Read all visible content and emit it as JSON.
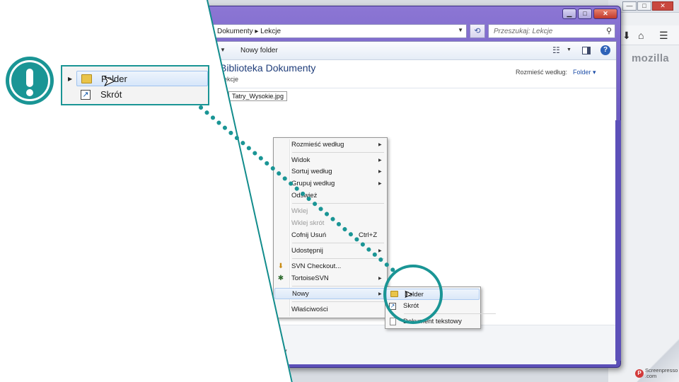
{
  "callout": {
    "zoom_items": [
      {
        "label": "Folder",
        "icon": "folder-icon",
        "highlighted": true
      },
      {
        "label": "Skrót",
        "icon": "shortcut-icon",
        "highlighted": false
      }
    ]
  },
  "background_app": {
    "brand_text": "mozilla"
  },
  "explorer": {
    "breadcrumb": "Dokumenty ▸ Lekcje",
    "breadcrumb_parts": [
      "Dokumenty",
      "Lekcje"
    ],
    "search_placeholder": "Przeszukaj: Lekcje",
    "new_folder_label": "Nowy folder",
    "library_title": "Biblioteka Dokumenty",
    "library_subtitle": "Lekcje",
    "arrange_label": "Rozmieść według:",
    "arrange_value": "Folder",
    "file_name": "Tatry_Wysokie.jpg",
    "status_fragment": "y"
  },
  "context_menu": {
    "items": [
      {
        "label": "Rozmieść według",
        "submenu": true
      },
      {
        "label": "Widok",
        "submenu": true
      },
      {
        "label": "Sortuj według",
        "submenu": true
      },
      {
        "label": "Grupuj według",
        "submenu": true
      },
      {
        "label": "Odśwież"
      },
      {
        "label": "Wklej",
        "disabled": true
      },
      {
        "label": "Wklej skrót",
        "disabled": true
      },
      {
        "label": "Cofnij Usuń",
        "shortcut": "Ctrl+Z"
      },
      {
        "label": "Udostępnij",
        "submenu": true
      },
      {
        "label": "SVN Checkout..."
      },
      {
        "label": "TortoiseSVN",
        "submenu": true
      },
      {
        "label": "Nowy",
        "submenu": true
      },
      {
        "label": "Właściwości"
      }
    ]
  },
  "submenu_nowy": {
    "items": [
      {
        "label": "Folder",
        "highlighted": true
      },
      {
        "label": "Skrót"
      },
      {
        "label": "Dokument tekstowy"
      }
    ]
  },
  "watermark": {
    "brand": "Screenpresso",
    "domain": ".com"
  },
  "colors": {
    "accent_teal": "#1a9595",
    "window_frame": "#6c5bc2",
    "highlight": "#dbe8f8"
  }
}
